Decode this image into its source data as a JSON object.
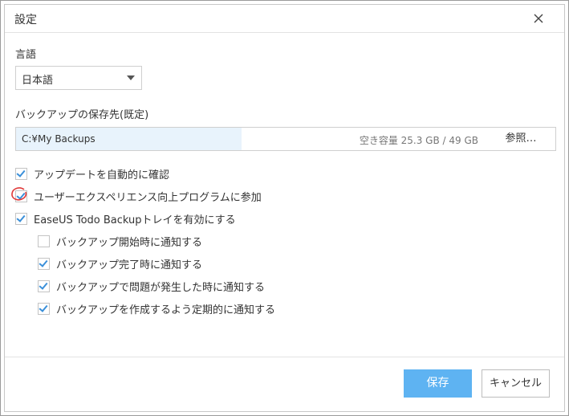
{
  "dialog": {
    "title": "設定"
  },
  "language": {
    "label": "言語",
    "selected": "日本語"
  },
  "backup_destination": {
    "label": "バックアップの保存先(既定)",
    "path": "C:¥My Backups",
    "capacity": "空き容量 25.3 GB / 49 GB",
    "usage_fraction": 0.48,
    "browse_label": "参照…"
  },
  "options": [
    {
      "label": "アップデートを自動的に確認",
      "checked": true,
      "indent": 0
    },
    {
      "label": "ユーザーエクスペリエンス向上プログラムに参加",
      "checked": true,
      "indent": 0
    },
    {
      "label": "EaseUS Todo Backupトレイを有効にする",
      "checked": true,
      "indent": 0
    },
    {
      "label": "バックアップ開始時に通知する",
      "checked": false,
      "indent": 1
    },
    {
      "label": "バックアップ完了時に通知する",
      "checked": true,
      "indent": 1
    },
    {
      "label": "バックアップで問題が発生した時に通知する",
      "checked": true,
      "indent": 1
    },
    {
      "label": "バックアップを作成するよう定期的に通知する",
      "checked": true,
      "indent": 1
    }
  ],
  "footer": {
    "save_label": "保存",
    "cancel_label": "キャンセル"
  },
  "colors": {
    "accent": "#5eb3f2",
    "check": "#3a8fd9",
    "annotation": "#e03a3a"
  },
  "icons": {
    "close": "close-icon",
    "dropdown": "chevron-down-icon"
  }
}
